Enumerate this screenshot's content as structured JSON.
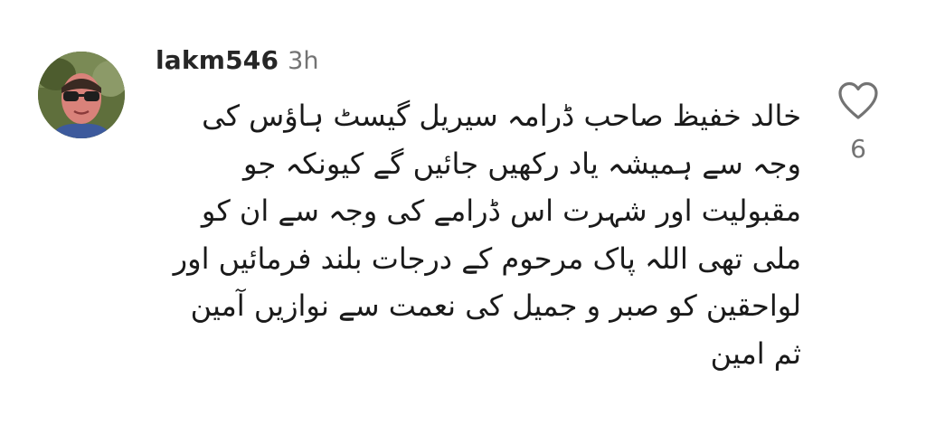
{
  "comment": {
    "username": "lakm546",
    "timestamp": "3h",
    "body_lines": [
      "خالد خفیظ صاحب ڈرامہ سیریل گیسٹ ہاؤس کی",
      "وجہ سے ہمیشہ  یاد رکھیں جائیں گے کیونکہ جو",
      "مقبولیت اور شہرت اس ڈرامے کی وجہ سے ان کو",
      "ملی تھی  اللہ پاک مرحوم کے درجات بلند فرمائیں اور",
      "لواحقین کو صبر و جمیل کی نعمت سے نوازیں آمین",
      "ثم امین"
    ],
    "like_icon": "heart-outline-icon",
    "like_count": "6"
  },
  "colors": {
    "username": "#262626",
    "meta": "#737373",
    "text": "#1a1a1a",
    "background": "#ffffff"
  }
}
